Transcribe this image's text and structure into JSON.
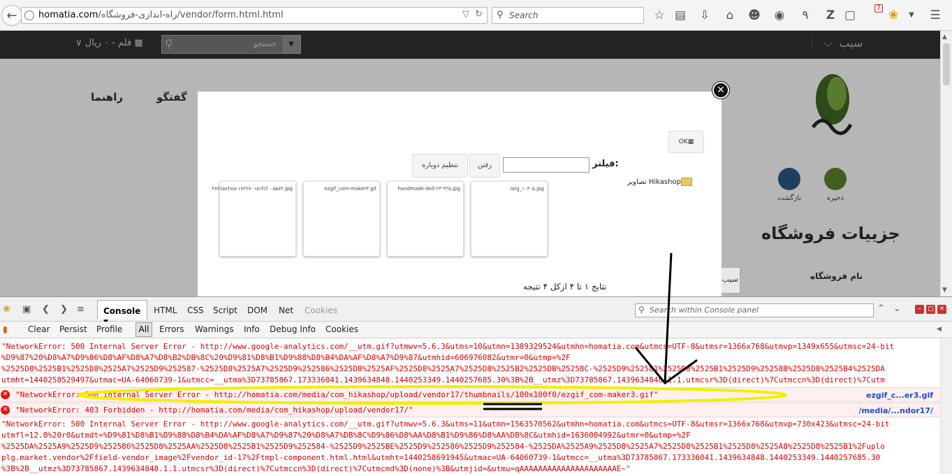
{
  "browser": {
    "url_host": "homatia.com",
    "url_path": "/راه-اندازی-فروشگاه/vendor/form.html.html",
    "search_placeholder": "Search",
    "badge_count": "7"
  },
  "site": {
    "search_placeholder": "جستجو",
    "cart_text": "قلم - ۰ ریال",
    "user_menu": "سیب",
    "nav": {
      "guide": "راهنما",
      "chat": "گفتگو"
    },
    "toolbar": {
      "save": "ذخیره",
      "back": "بازگشت"
    },
    "heading": "جزییات فروشگاه",
    "field_label": "نام فروشگاه",
    "field_value": "سیب"
  },
  "modal": {
    "ok": "OK",
    "filter_label": "فیلتر:",
    "filter_value": "",
    "go": "رفتن",
    "reset": "تنظیم دوباره",
    "folder": "تصاویر Hikashop",
    "thumbs": [
      {
        "name": "larg_۱۰۳۰۵.jpg"
      },
      {
        "name": "handmade-doll-۲۴-۴۲۵.jpg"
      },
      {
        "name": "ezgif_com-maker۳.gif"
      },
      {
        "name": "۴۸۲۶۵۸۴aa-۱۷۲۲۷۰۱۵۱fcf۰۰۵۵۷۲.jpg"
      }
    ],
    "results": "نتایج ۱ تا ۴ ازکل ۴ نتیجه"
  },
  "firebug": {
    "tabs": [
      "Console",
      "HTML",
      "CSS",
      "Script",
      "DOM",
      "Net",
      "Cookies"
    ],
    "search_placeholder": "Search within Console panel",
    "toolbar": [
      "Clear",
      "Persist",
      "Profile"
    ],
    "filters": [
      "All",
      "Errors",
      "Warnings",
      "Info",
      "Debug Info",
      "Cookies"
    ]
  },
  "console": {
    "block1": [
      "\"NetworkError: 500 Internal Server Error - http://www.google-analytics.com/__utm.gif?utmwv=5.6.3&utms=10&utmn=1389329524&utmhn=homatia.com&utmcs=UTF-8&utmsr=1366x768&utmvp=1349x655&utmsc=24-bit",
      "%D9%87%20%D8%A7%D9%86%D8%AF%D8%A7%D8%B2%DB%8C%20%D9%81%D8%B1%D9%88%D8%B4%DA%AF%D8%A7%D9%87&utmhid=606976082&utmr=0&utmp=%2F",
      "%2525D8%2525B1%2525D8%2525A7%2525D9%252587-%2525D8%2525A7%2525D9%252586%2525D8%2525AF%2525D8%2525A7%2525D8%2525B2%2525DB%25258C-%2525D9%252581%2525D8%2525B1%2525D9%252588%2525D8%2525B4%2525DA",
      "utmht=1440258529497&utmac=UA-64060739-1&utmcc=__utma%3D73785867.173336041.1439634848.1440253349.1440257685.30%3B%2B__utmz%3D73785867.1439634848.1.1.utmcsr%3D(direct)%7Cutmccn%3D(direct)%7Cutm"
    ],
    "error1": {
      "text": "\"NetworkError: 500 Internal Server Error - http://homatia.com/media/com_hikashop/upload/vendor17/thumbnails/100x100f0/ezgif_com-maker3.gif\"",
      "source": "ezgif_c...er3.gif"
    },
    "error2": {
      "text": "\"NetworkError: 403 Forbidden - http://homatia.com/media/com_hikashop/upload/vendor17/\"",
      "source": "/media/...ndor17/"
    },
    "block2": [
      "\"NetworkError: 500 Internal Server Error - http://www.google-analytics.com/__utm.gif?utmwv=5.6.3&utms=11&utmn=1563570562&utmhn=homatia.com&utmcs=UTF-8&utmsr=1366x768&utmvp=730x423&utmsc=24-bit",
      "utmfl=12.0%20r0&utmdt=%D9%81%D8%B1%D9%88%D8%B4%DA%AF%D8%A7%D9%87%20%D8%A7%DB%8C%D9%86%D8%AA%D8%B1%D9%86%D8%AA%DB%8C&utmhid=1636004992&utmr=0&utmp=%2F",
      "%2525DA%2525A9%2525D9%252586%2525D8%2525AA%2525D8%2525B1%2525D9%252584-%2525D9%2525BE%2525D9%252586%2525D9%252584-%2525DA%2525A9%2525D8%2525A7%2525D8%2525B1%2525D8%2525A8%2525D8%2525B1%2Fuplo",
      "plg.market.vendor%2Ffield-vendor_image%2Fvendor_id-17%2Ftmpl-component.html.html&utmht=1440258691945&utmac=UA-64060739-1&utmcc=__utma%3D73785867.173336041.1439634848.1440253349.1440257685.30",
      "%3B%2B__utmz%3D73785867.1439634848.1.1.utmcsr%3D(direct)%7Cutmccn%3D(direct)%7Cutmcmd%3D(none)%3B&utmjid=&utmu=qAAAAAAAAAAAAAAAAAAAAAE~\""
    ]
  }
}
